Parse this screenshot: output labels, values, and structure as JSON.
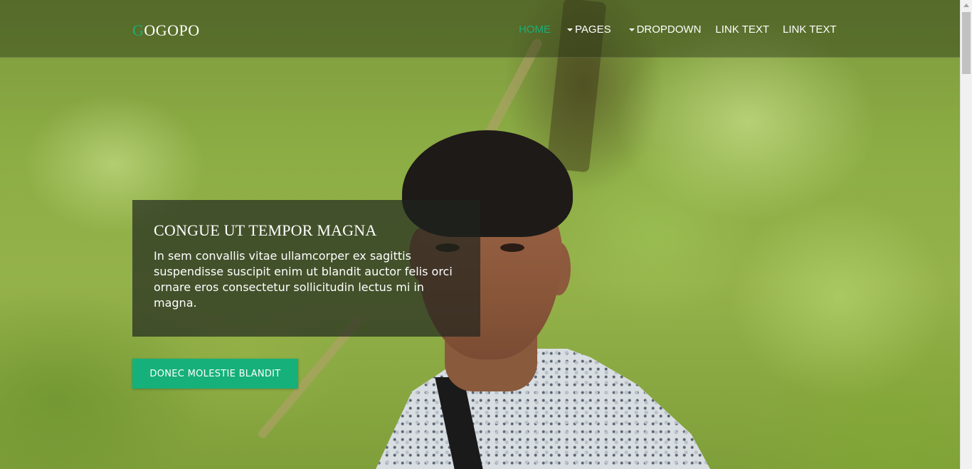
{
  "navbar": {
    "brand_first": "G",
    "brand_rest": "OGOPO",
    "items": [
      {
        "label": "HOME",
        "active": true,
        "dropdown": false
      },
      {
        "label": "PAGES",
        "active": false,
        "dropdown": true
      },
      {
        "label": "DROPDOWN",
        "active": false,
        "dropdown": true
      },
      {
        "label": "LINK TEXT",
        "active": false,
        "dropdown": false
      },
      {
        "label": "LINK TEXT",
        "active": false,
        "dropdown": false
      }
    ]
  },
  "hero": {
    "title": "CONGUE UT TEMPOR MAGNA",
    "text": "In sem convallis vitae ullamcorper ex sagittis suspendisse suscipit enim ut blandit auctor felis orci ornare eros consectetur sollicitudin lectus mi in magna.",
    "button_label": "DONEC MOLESTIE BLANDIT"
  },
  "colors": {
    "accent": "#16b07a",
    "nav_text": "#ffffff",
    "hero_box": "rgba(30,35,30,0.68)"
  },
  "icons": {
    "dropdown_caret": "caret-down-icon"
  }
}
